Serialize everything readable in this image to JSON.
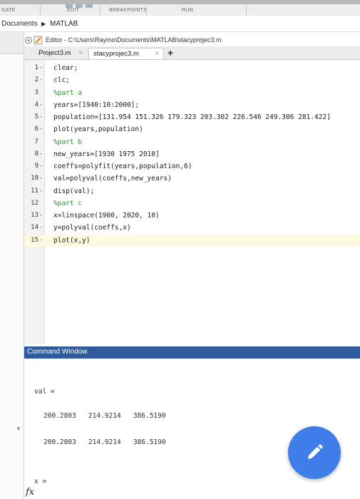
{
  "toolstrip": {
    "sections": [
      "GATE",
      "EDIT",
      "BREAKPOINTS",
      "RUN"
    ]
  },
  "path": {
    "items": [
      "Documents",
      "MATLAB"
    ],
    "separator": "▶"
  },
  "editor": {
    "title": "Editor - C:\\Users\\Raymo\\Documents\\MATLAB\\stacyprojec3.m",
    "tabs": [
      {
        "label": "Project3.m",
        "close": "×"
      },
      {
        "label": "stacyprojec3.m",
        "close": "×"
      }
    ],
    "add_tab": "+",
    "lines": [
      {
        "num": "1",
        "dash": "-",
        "text": "clear;"
      },
      {
        "num": "2",
        "dash": "-",
        "text": "clc;"
      },
      {
        "num": "3",
        "dash": "",
        "text": "%part a"
      },
      {
        "num": "4",
        "dash": "-",
        "text": "years=[1940:10:2000];"
      },
      {
        "num": "5",
        "dash": "-",
        "text": "population=[131.954 151.326 179.323 203.302 226.546 249.306 281.422]"
      },
      {
        "num": "6",
        "dash": "-",
        "text": "plot(years,population)"
      },
      {
        "num": "7",
        "dash": "",
        "text": "%part b"
      },
      {
        "num": "8",
        "dash": "-",
        "text": "new_years=[1930 1975 2010]"
      },
      {
        "num": "9",
        "dash": "-",
        "text": "coeffs=polyfit(years,population,6)"
      },
      {
        "num": "10",
        "dash": "-",
        "text": "val=polyval(coeffs,new_years)"
      },
      {
        "num": "11",
        "dash": "-",
        "text": "disp(val);"
      },
      {
        "num": "12",
        "dash": "",
        "text": "%part c"
      },
      {
        "num": "13",
        "dash": "-",
        "text": "x=linspace(1900, 2020, 10)"
      },
      {
        "num": "14",
        "dash": "-",
        "text": "y=polyval(coeffs,x)"
      },
      {
        "num": "15",
        "dash": "-",
        "text": "plot(x,y)"
      }
    ]
  },
  "command_window": {
    "title": "Command Window",
    "lines": [
      "val =",
      "200.2803   214.9214   386.5190",
      "200.2803   214.9214   386.5190",
      "x ="
    ],
    "prompt_icon": "fx"
  },
  "fab": {
    "icon": "pencil-icon",
    "color": "#3f7ee8"
  },
  "colors": {
    "accent": "#2e5c9a",
    "comment": "#2f8f2f"
  }
}
